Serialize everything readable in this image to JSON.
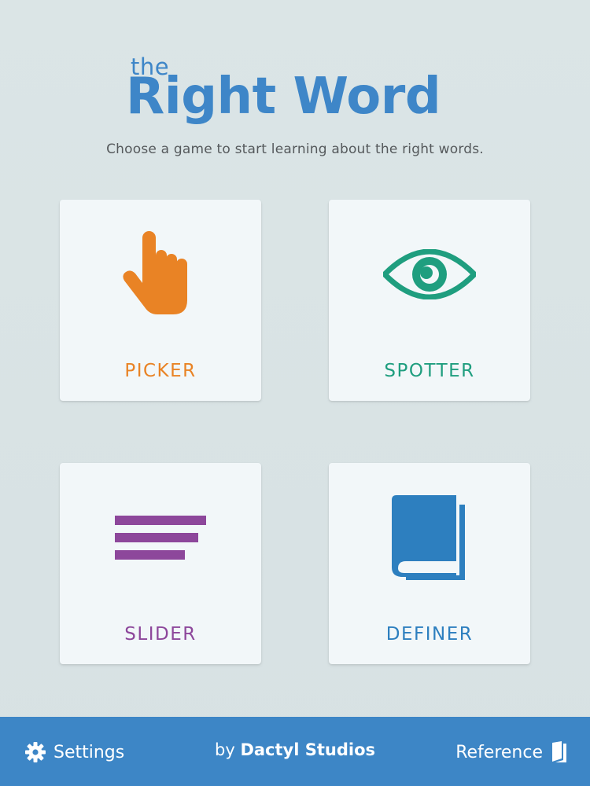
{
  "header": {
    "logo_small": "the",
    "logo_large": "Right Word",
    "subtitle": "Choose a game to start learning about the right words."
  },
  "games": [
    {
      "label": "PICKER",
      "icon": "pointing-hand-icon",
      "color": "#e98325"
    },
    {
      "label": "SPOTTER",
      "icon": "eye-icon",
      "color": "#1f9e7f"
    },
    {
      "label": "SLIDER",
      "icon": "text-lines-icon",
      "color": "#8d479b"
    },
    {
      "label": "DEFINER",
      "icon": "book-icon",
      "color": "#2d7fbf"
    }
  ],
  "footer": {
    "settings_label": "Settings",
    "settings_icon": "gear-icon",
    "credit_prefix": "by",
    "credit_name": "Dactyl Studios",
    "reference_label": "Reference",
    "reference_icon": "book-icon",
    "background": "#3d86c6"
  },
  "colors": {
    "brand_blue": "#3e86c8",
    "background": "#dbe5e6",
    "card": "#f2f7f9"
  }
}
